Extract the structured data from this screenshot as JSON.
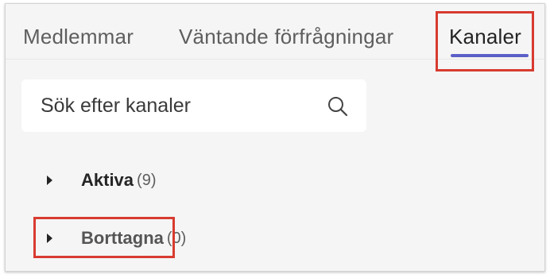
{
  "tabs": {
    "members": "Medlemmar",
    "pending": "Väntande förfrågningar",
    "channels": "Kanaler"
  },
  "search": {
    "placeholder": "Sök efter kanaler",
    "icon": "search-icon"
  },
  "groups": [
    {
      "label": "Aktiva",
      "count": "(9)",
      "icon": "caret-right-icon"
    },
    {
      "label": "Borttagna",
      "count": "(0)",
      "icon": "caret-right-icon"
    }
  ],
  "colors": {
    "accent": "#5b5fc7",
    "highlight": "#d83b30",
    "panel_bg": "#f5f5f5"
  }
}
